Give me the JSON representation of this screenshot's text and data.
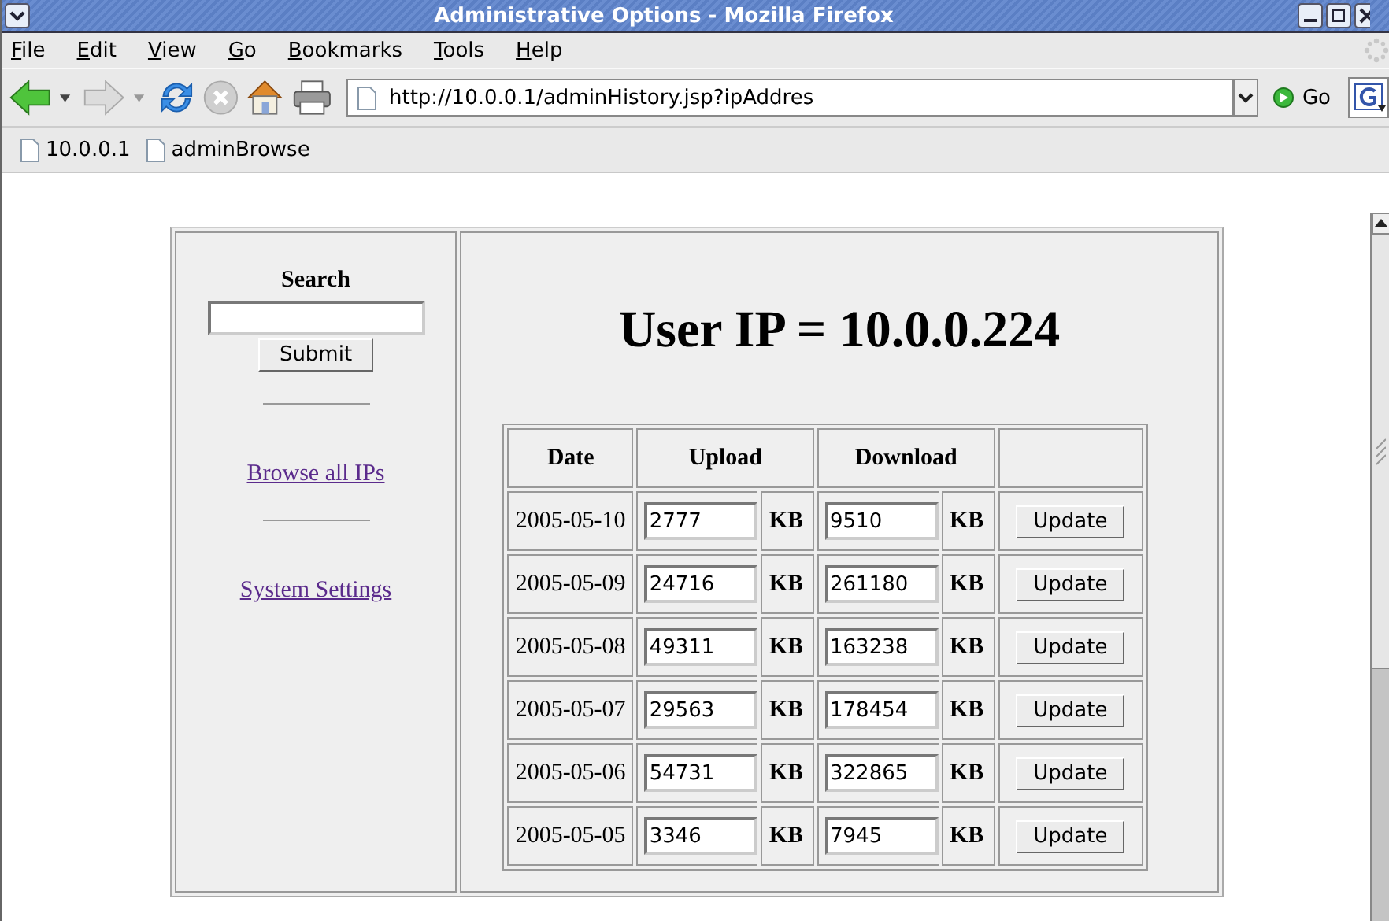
{
  "window": {
    "title": "Administrative Options - Mozilla Firefox"
  },
  "menu": [
    "File",
    "Edit",
    "View",
    "Go",
    "Bookmarks",
    "Tools",
    "Help"
  ],
  "toolbar": {
    "url": "http://10.0.0.1/adminHistory.jsp?ipAddres",
    "go": "Go"
  },
  "bookmarks": [
    "10.0.0.1",
    "adminBrowse"
  ],
  "sidebar": {
    "search_label": "Search",
    "submit": "Submit",
    "links": [
      "Browse all IPs",
      "System Settings"
    ]
  },
  "heading": "User IP = 10.0.0.224",
  "table": {
    "columns": [
      "Date",
      "Upload",
      "Download"
    ],
    "rows": [
      {
        "date": "2005-05-10",
        "upload": "2777",
        "upload_unit": "KB",
        "download": "9510",
        "download_unit": "KB",
        "action": "Update"
      },
      {
        "date": "2005-05-09",
        "upload": "24716",
        "upload_unit": "KB",
        "download": "261180",
        "download_unit": "KB",
        "action": "Update"
      },
      {
        "date": "2005-05-08",
        "upload": "49311",
        "upload_unit": "KB",
        "download": "163238",
        "download_unit": "KB",
        "action": "Update"
      },
      {
        "date": "2005-05-07",
        "upload": "29563",
        "upload_unit": "KB",
        "download": "178454",
        "download_unit": "KB",
        "action": "Update"
      },
      {
        "date": "2005-05-06",
        "upload": "54731",
        "upload_unit": "KB",
        "download": "322865",
        "download_unit": "KB",
        "action": "Update"
      },
      {
        "date": "2005-05-05",
        "upload": "3346",
        "upload_unit": "KB",
        "download": "7945",
        "download_unit": "KB",
        "action": "Update"
      }
    ]
  }
}
